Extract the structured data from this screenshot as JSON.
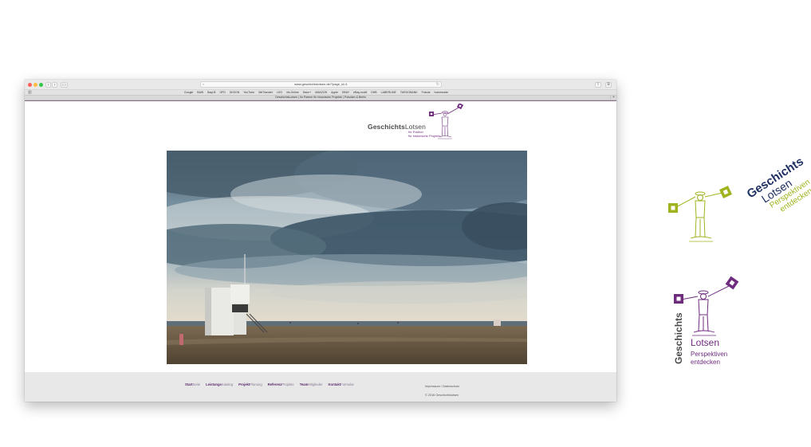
{
  "browser": {
    "url": "www.geschichtslotsen.de/?page_id=1",
    "tab_title": "GeschichtsLotsen | Ihr Partner für historische Projekte | Potsdam & Berlin",
    "bookmarks": [
      "Google",
      "BAW",
      "BayLB",
      "GFD",
      "DIGION",
      "YouTube",
      "WeTransfer",
      "LEO",
      "iris.Online",
      "Hann+",
      "AMAZON",
      "Apple",
      "EBAY",
      "eBay.mobil",
      "DHB",
      "LABERLINE",
      "TARGOBANK",
      "Fotoria",
      "homemade"
    ]
  },
  "site": {
    "brand_bold": "Geschichts",
    "brand_regular": "Lotsen",
    "tagline_line1": "Ihr Partner",
    "tagline_line2": "für historische Projekte"
  },
  "footer": {
    "nav": [
      {
        "bold": "Start",
        "rest": "Seite"
      },
      {
        "bold": "Leistungs",
        "rest": "Katalog"
      },
      {
        "bold": "Projekt",
        "rest": "Planung"
      },
      {
        "bold": "Referenz",
        "rest": "Projekte"
      },
      {
        "bold": "Team",
        "rest": "Mitglieder"
      },
      {
        "bold": "Kontakt",
        "rest": "Formular"
      }
    ],
    "legal": "Impressum / Datenschutz",
    "copyright": "© 2016 Geschichtslotsen"
  },
  "logo_variants": {
    "a": {
      "line1": "Geschichts",
      "line2": "Lotsen",
      "line3": "Perspektiven",
      "line4": "entdecken"
    },
    "b": {
      "vertical": "Geschichts",
      "line1": "Lotsen",
      "line2": "Perspektiven",
      "line3": "entdecken"
    }
  },
  "colors": {
    "purple": "#6f2c7f",
    "navy": "#1f3263",
    "lime": "#a0b31e"
  }
}
